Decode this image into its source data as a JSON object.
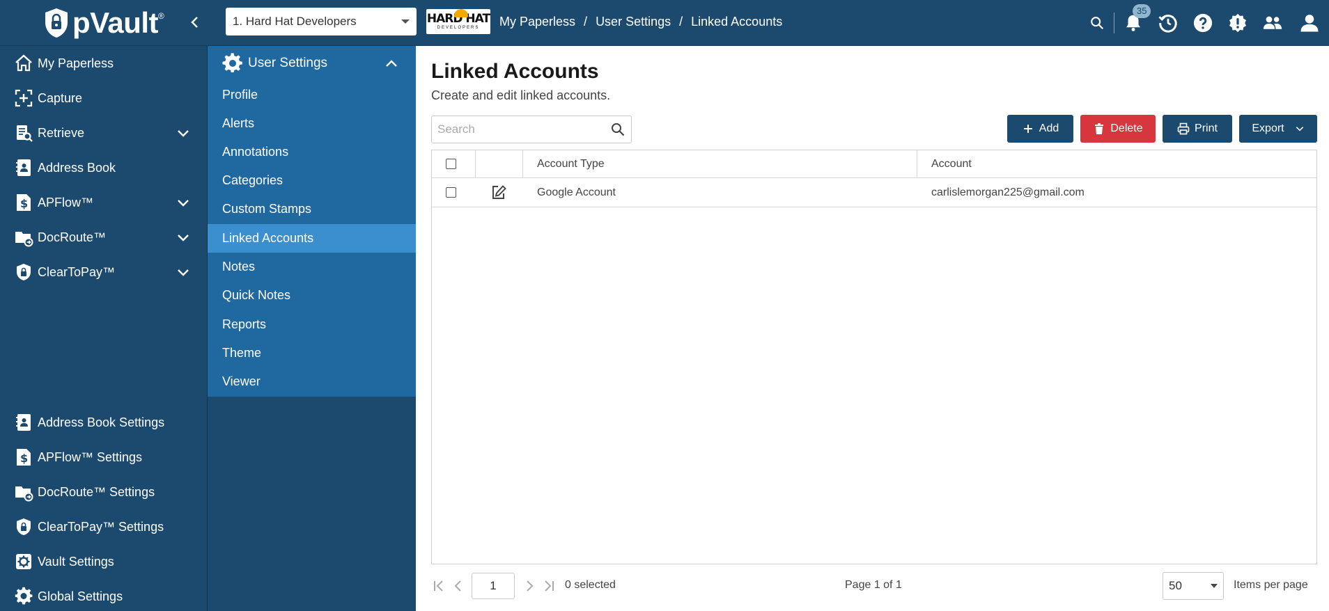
{
  "app": {
    "logo_text": "pVault",
    "logo_mark": "®"
  },
  "header": {
    "vault_select": "1. Hard Hat Developers",
    "company_logo_main": "HARD HAT",
    "company_logo_sub": "DEVELOPERS",
    "breadcrumb": [
      "My Paperless",
      "User Settings",
      "Linked Accounts"
    ],
    "breadcrumb_sep": "/",
    "notification_count": "35",
    "icons": [
      "search-icon",
      "bell-icon",
      "history-icon",
      "help-icon",
      "alert-icon",
      "users-icon",
      "profile-icon"
    ]
  },
  "sidebar": {
    "items": [
      {
        "label": "My Paperless",
        "icon": "home-icon",
        "expandable": false
      },
      {
        "label": "Capture",
        "icon": "capture-icon",
        "expandable": false
      },
      {
        "label": "Retrieve",
        "icon": "retrieve-icon",
        "expandable": true
      },
      {
        "label": "Address Book",
        "icon": "address-book-icon",
        "expandable": false
      },
      {
        "label": "APFlow™",
        "icon": "dollar-doc-icon",
        "expandable": true
      },
      {
        "label": "DocRoute™",
        "icon": "folder-route-icon",
        "expandable": true
      },
      {
        "label": "ClearToPay™",
        "icon": "shield-lock-icon",
        "expandable": true
      }
    ],
    "settings_items": [
      {
        "label": "Address Book Settings",
        "icon": "address-book-icon"
      },
      {
        "label": "APFlow™ Settings",
        "icon": "dollar-doc-icon"
      },
      {
        "label": "DocRoute™ Settings",
        "icon": "folder-route-icon"
      },
      {
        "label": "ClearToPay™ Settings",
        "icon": "shield-lock-icon"
      },
      {
        "label": "Vault Settings",
        "icon": "gear-icon"
      },
      {
        "label": "Global Settings",
        "icon": "gear-icon"
      }
    ]
  },
  "submenu": {
    "title": "User Settings",
    "items": [
      {
        "label": "Profile"
      },
      {
        "label": "Alerts"
      },
      {
        "label": "Annotations"
      },
      {
        "label": "Categories"
      },
      {
        "label": "Custom Stamps"
      },
      {
        "label": "Linked Accounts",
        "active": true
      },
      {
        "label": "Notes"
      },
      {
        "label": "Quick Notes"
      },
      {
        "label": "Reports"
      },
      {
        "label": "Theme"
      },
      {
        "label": "Viewer"
      }
    ]
  },
  "main": {
    "title": "Linked Accounts",
    "subtitle": "Create and edit linked accounts.",
    "search_placeholder": "Search",
    "buttons": {
      "add": "Add",
      "delete": "Delete",
      "print": "Print",
      "export": "Export"
    },
    "columns": [
      "Account Type",
      "Account"
    ],
    "rows": [
      {
        "account_type": "Google Account",
        "account": "carlislemorgan225@gmail.com"
      }
    ],
    "pager": {
      "page": "1",
      "selected": "0 selected",
      "page_info": "Page 1 of 1",
      "per_page": "50",
      "per_page_label": "Items per page"
    }
  },
  "colors": {
    "nav_dark": "#1c4a6e",
    "submenu_blue": "#2068a0",
    "active_item": "#3c8fce",
    "delete_red": "#d7363f"
  }
}
